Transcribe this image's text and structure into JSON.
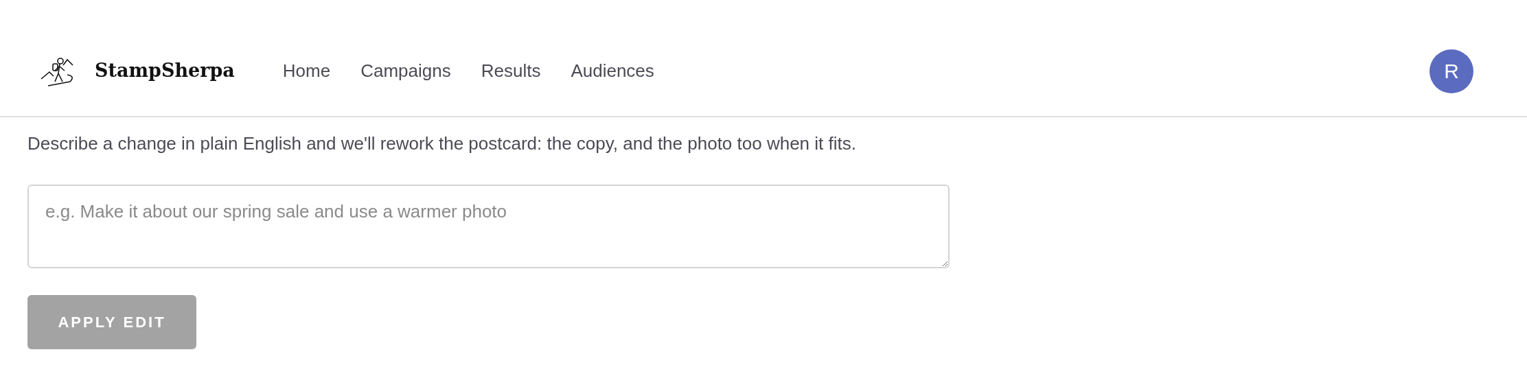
{
  "header": {
    "brand": "StampSherpa",
    "nav": [
      {
        "label": "Home"
      },
      {
        "label": "Campaigns"
      },
      {
        "label": "Results"
      },
      {
        "label": "Audiences"
      }
    ],
    "avatar": "R"
  },
  "section": {
    "description": "Describe a change in plain English and we'll rework the postcard: the copy, and the photo too when it fits.",
    "field": {
      "placeholder": "e.g. Make it about our spring sale and use a warmer photo"
    },
    "button": {
      "label": "APPLY EDIT",
      "disabled": true
    }
  }
}
